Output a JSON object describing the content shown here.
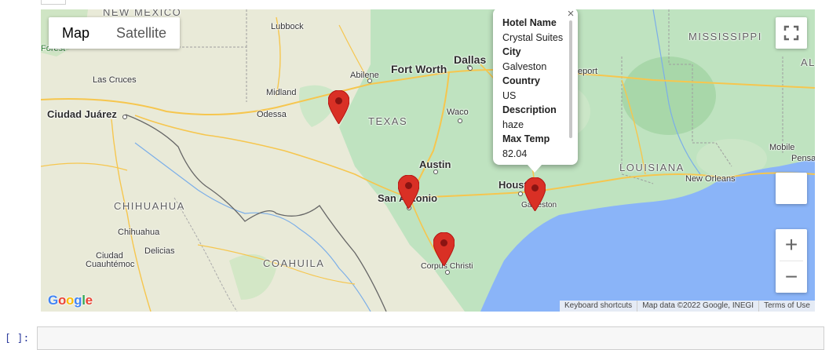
{
  "map": {
    "type_buttons": {
      "map": "Map",
      "satellite": "Satellite"
    },
    "labels": {
      "new_mexico": "NEW MEXICO",
      "mississippi": "MISSISSIPPI",
      "al": "AL",
      "texas": "TEXAS",
      "louisiana": "LOUISIANA",
      "chihuahua_state": "CHIHUAHUA",
      "coahuila": "COAHUILA",
      "forest": "Forest",
      "lubbock": "Lubbock",
      "las_cruces": "Las Cruces",
      "abilene": "Abilene",
      "fort_worth": "Fort Worth",
      "dallas": "Dallas",
      "shreveport": "eport",
      "midland": "Midland",
      "odessa": "Odessa",
      "ciudad_juarez": "Ciudad Juárez",
      "waco": "Waco",
      "austin": "Austin",
      "san_antonio": "San Antonio",
      "houston": "Houston",
      "galveston": "Galveston",
      "new_orleans": "New Orleans",
      "mobile": "Mobile",
      "pensacola": "Pensa",
      "chihuahua_city": "Chihuahua",
      "delicias": "Delicias",
      "ciudad_cuauhtemoc_1": "Ciudad",
      "ciudad_cuauhtemoc_2": "Cuauhtémoc",
      "corpus_christi": "Corpus Christi"
    },
    "info_window": {
      "fields": [
        {
          "key": "Hotel Name",
          "value": "Crystal Suites"
        },
        {
          "key": "City",
          "value": "Galveston"
        },
        {
          "key": "Country",
          "value": "US"
        },
        {
          "key": "Description",
          "value": "haze"
        },
        {
          "key": "Max Temp",
          "value": "82.04"
        }
      ],
      "close": "×"
    },
    "markers": [
      "marker-odessa-area",
      "marker-san-antonio",
      "marker-corpus-christi",
      "marker-galveston"
    ],
    "zoom": {
      "in": "+",
      "out": "−"
    },
    "attribution": {
      "shortcuts": "Keyboard shortcuts",
      "data": "Map data ©2022 Google, INEGI",
      "terms": "Terms of Use"
    },
    "logo": "Google",
    "colors": {
      "land": "#e9ead8",
      "green": "#bfe3c0",
      "water": "#8ab4f8",
      "marker": "#d93025",
      "road": "#f6c64e"
    }
  },
  "notebook": {
    "prompt": "[ ]:"
  }
}
